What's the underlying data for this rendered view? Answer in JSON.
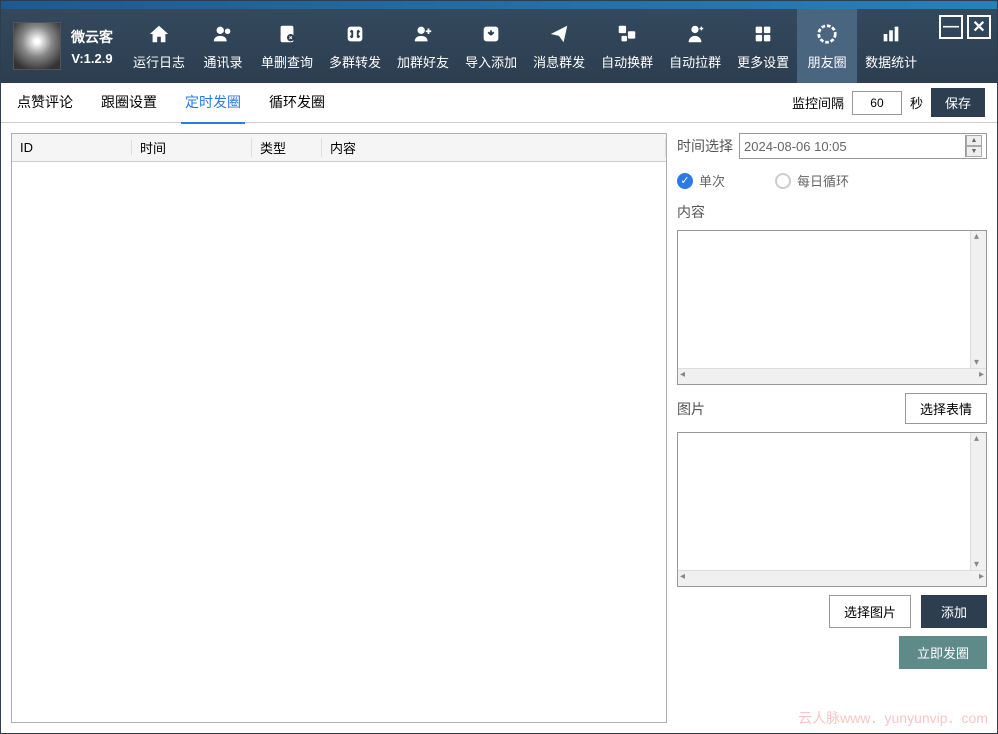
{
  "app": {
    "name": "微云客",
    "version": "V:1.2.9"
  },
  "nav": [
    {
      "label": "运行日志",
      "icon": "home"
    },
    {
      "label": "通讯录",
      "icon": "contacts"
    },
    {
      "label": "单删查询",
      "icon": "delete-query"
    },
    {
      "label": "多群转发",
      "icon": "forward"
    },
    {
      "label": "加群好友",
      "icon": "add-friend"
    },
    {
      "label": "导入添加",
      "icon": "import"
    },
    {
      "label": "消息群发",
      "icon": "send"
    },
    {
      "label": "自动换群",
      "icon": "switch-group"
    },
    {
      "label": "自动拉群",
      "icon": "pull-group"
    },
    {
      "label": "更多设置",
      "icon": "settings"
    },
    {
      "label": "朋友圈",
      "icon": "moments",
      "active": true
    },
    {
      "label": "数据统计",
      "icon": "stats"
    }
  ],
  "tabs": [
    {
      "label": "点赞评论"
    },
    {
      "label": "跟圈设置"
    },
    {
      "label": "定时发圈",
      "active": true
    },
    {
      "label": "循环发圈"
    }
  ],
  "toolbar": {
    "interval_label": "监控间隔",
    "interval_value": "60",
    "interval_unit": "秒",
    "save_label": "保存"
  },
  "table": {
    "headers": {
      "id": "ID",
      "time": "时间",
      "type": "类型",
      "content": "内容"
    }
  },
  "form": {
    "time_label": "时间选择",
    "time_value": "2024-08-06 10:05",
    "radio_once": "单次",
    "radio_daily": "每日循环",
    "content_label": "内容",
    "image_label": "图片",
    "select_emoji": "选择表情",
    "select_image": "选择图片",
    "add_btn": "添加",
    "publish_btn": "立即发圈"
  },
  "watermark": "云人脉www．yunyunvip．com"
}
